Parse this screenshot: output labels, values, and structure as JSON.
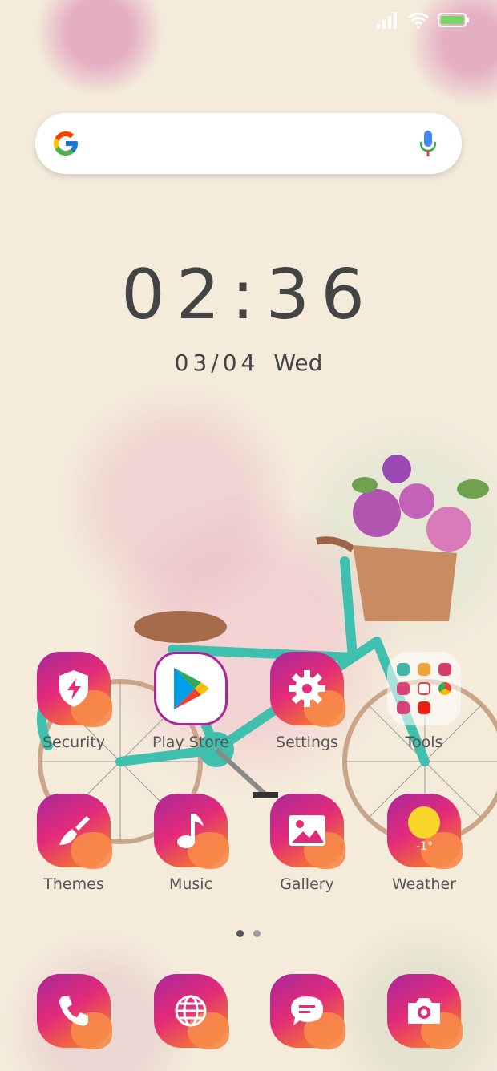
{
  "status_bar": {
    "signal_icon": "signal-icon",
    "wifi_icon": "wifi-icon",
    "battery_icon": "battery-icon"
  },
  "search_bar": {
    "logo": "google-g-icon",
    "mic": "mic-icon"
  },
  "clock": {
    "time": "02:36",
    "date": "03/04",
    "weekday": "Wed"
  },
  "apps_row1": [
    {
      "label": "Security",
      "icon": "shield-bolt-icon"
    },
    {
      "label": "Play Store",
      "icon": "play-store-icon"
    },
    {
      "label": "Settings",
      "icon": "gear-icon"
    },
    {
      "label": "Tools",
      "icon": "folder-icon"
    }
  ],
  "apps_row2": [
    {
      "label": "Themes",
      "icon": "paintbrush-icon"
    },
    {
      "label": "Music",
      "icon": "music-note-icon"
    },
    {
      "label": "Gallery",
      "icon": "image-icon"
    },
    {
      "label": "Weather",
      "icon": "sun-cloud-icon",
      "temp": "-1°"
    }
  ],
  "page_indicator": {
    "count": 2,
    "active": 0
  },
  "dock": [
    {
      "icon": "phone-icon"
    },
    {
      "icon": "globe-icon"
    },
    {
      "icon": "message-icon"
    },
    {
      "icon": "camera-icon"
    }
  ],
  "colors": {
    "accent_pink": "#e22b7a",
    "accent_purple": "#a8289a",
    "accent_orange": "#f59a3c",
    "bike_teal": "#3fbfae"
  }
}
